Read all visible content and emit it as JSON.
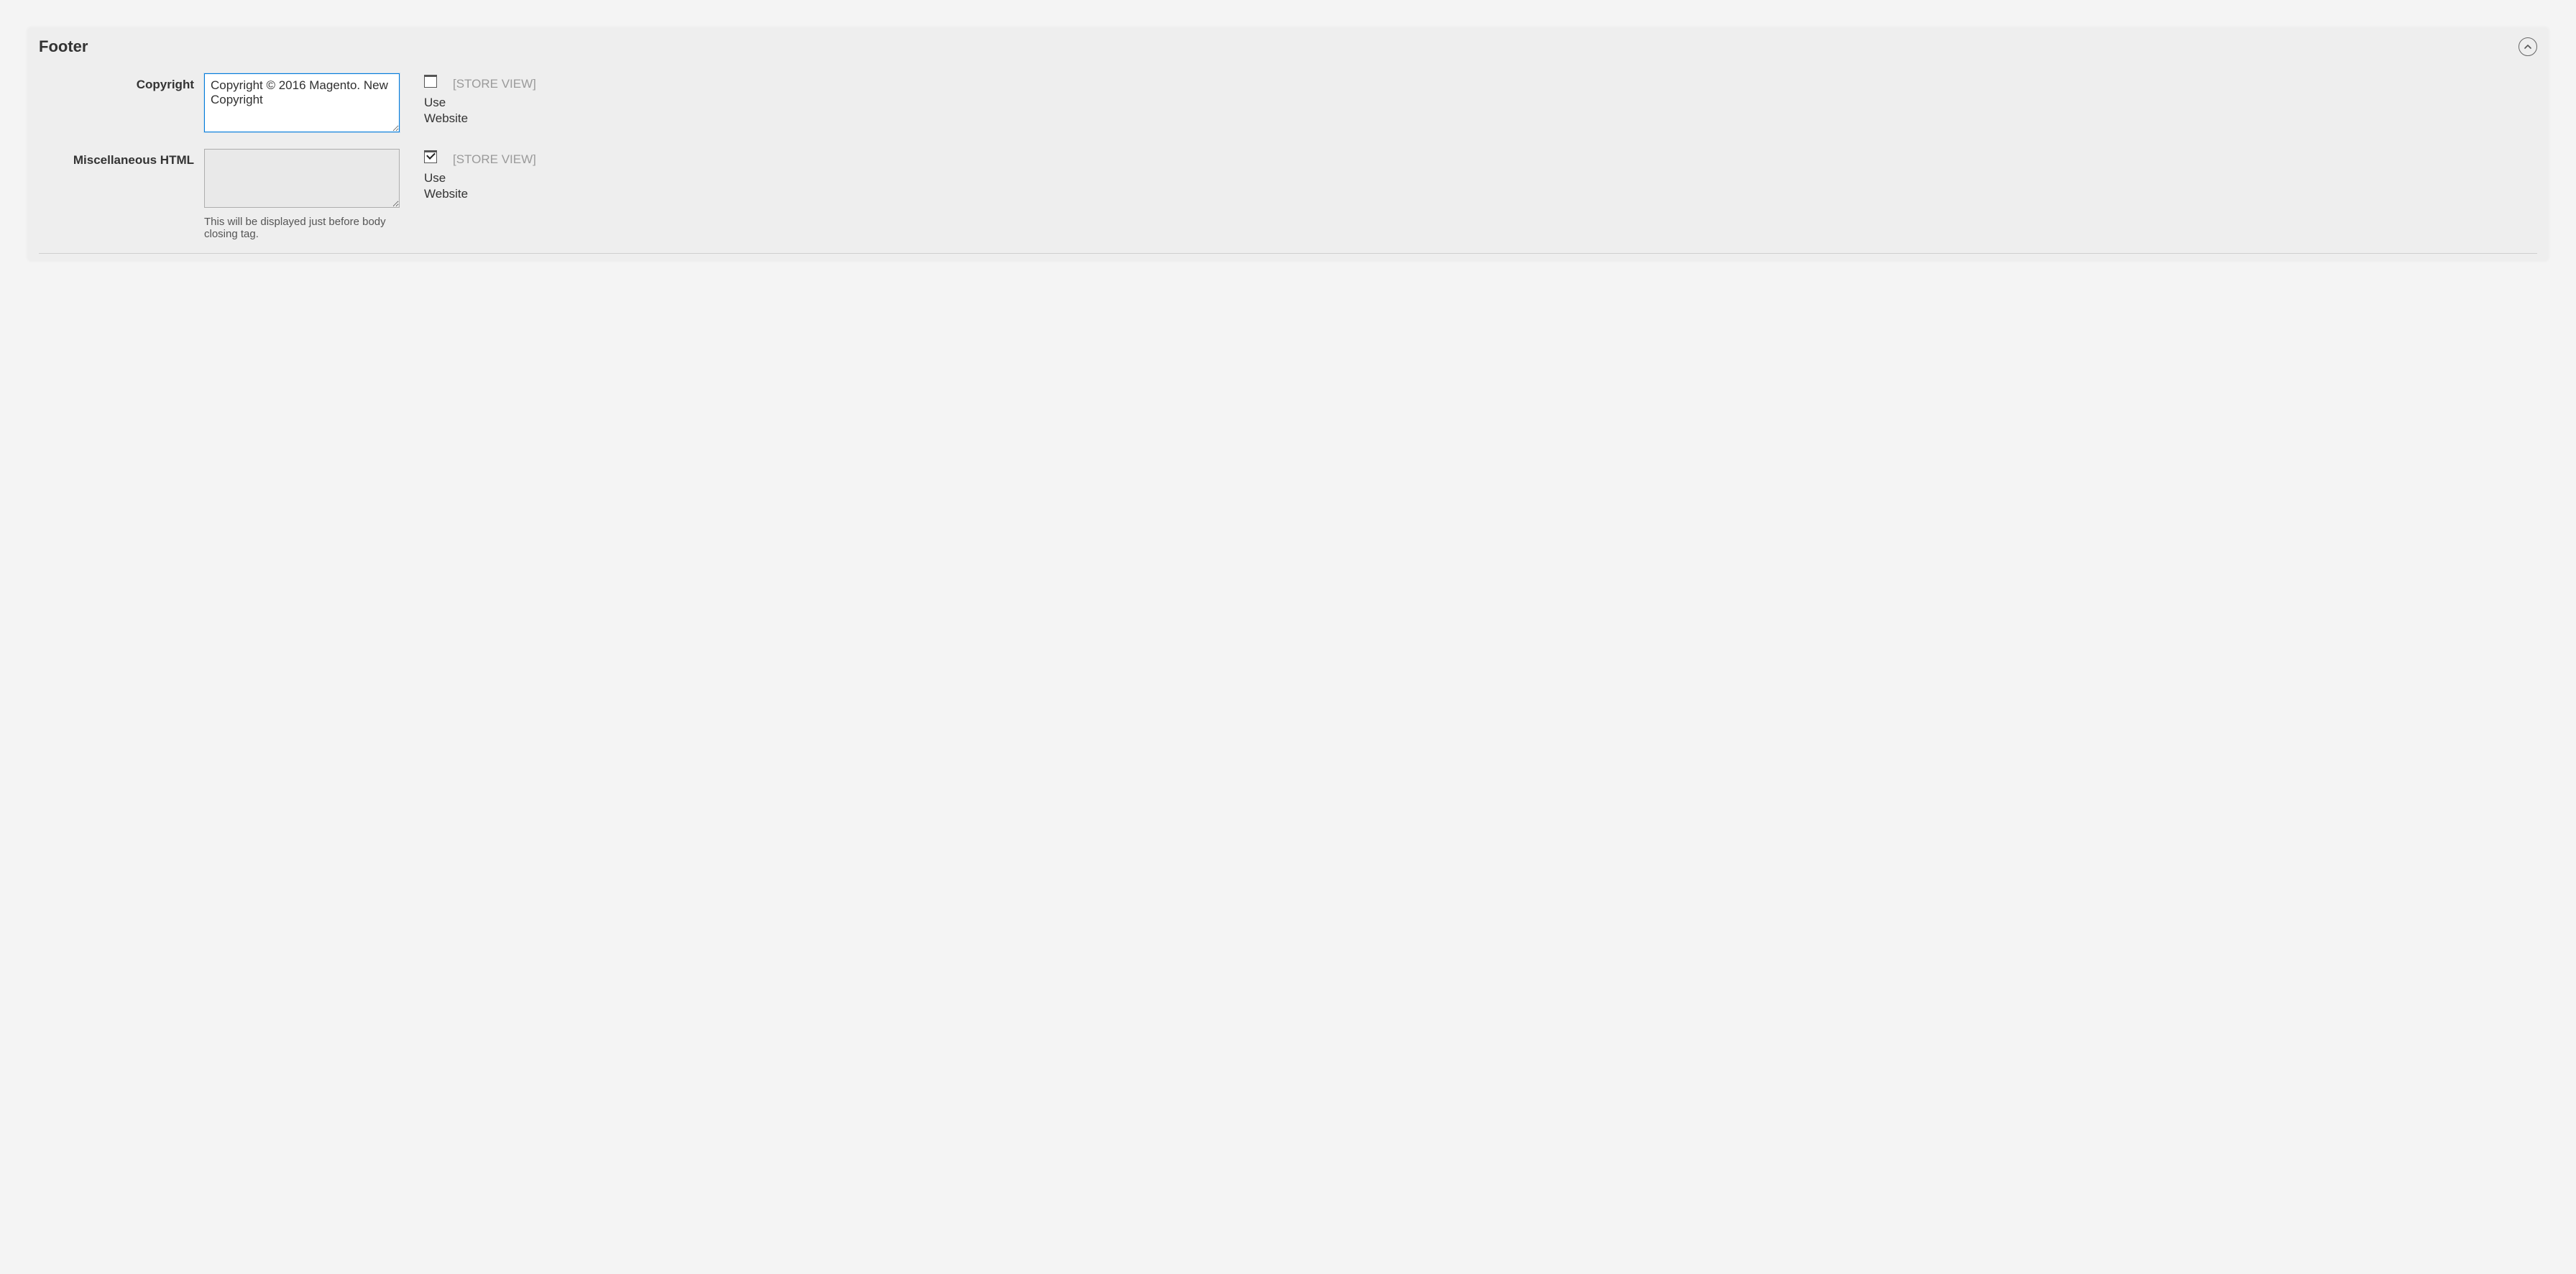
{
  "section": {
    "title": "Footer"
  },
  "fields": {
    "copyright": {
      "label": "Copyright",
      "value": "Copyright © 2016 Magento. New Copyright",
      "use_website_label": "Use Website",
      "use_website_checked": false,
      "scope": "[STORE VIEW]"
    },
    "misc_html": {
      "label": "Miscellaneous HTML",
      "value": "",
      "helper": "This will be displayed just before body closing tag.",
      "use_website_label": "Use Website",
      "use_website_checked": true,
      "scope": "[STORE VIEW]"
    }
  }
}
